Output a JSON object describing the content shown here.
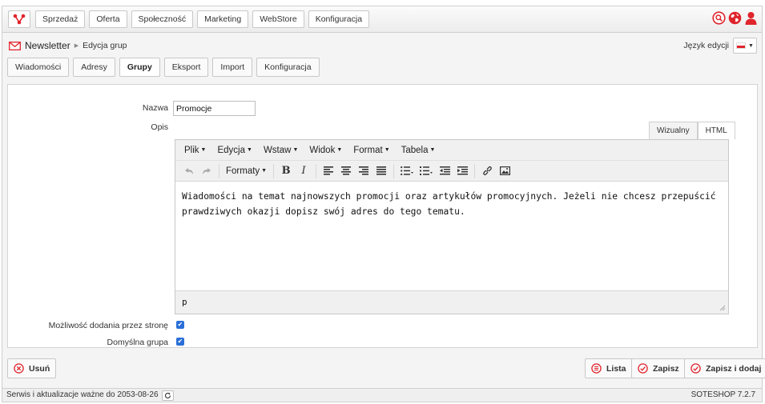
{
  "topnav": {
    "items": [
      "Sprzedaż",
      "Oferta",
      "Społeczność",
      "Marketing",
      "WebStore",
      "Konfiguracja"
    ]
  },
  "breadcrumb": {
    "module": "Newsletter",
    "page": "Edycja grup"
  },
  "language": {
    "label": "Język edycji"
  },
  "tabs": {
    "items": [
      "Wiadomości",
      "Adresy",
      "Grupy",
      "Eksport",
      "Import",
      "Konfiguracja"
    ],
    "active": "Grupy"
  },
  "form": {
    "name_label": "Nazwa",
    "name_value": "Promocje",
    "description_label": "Opis",
    "editor_tabs": [
      "Wizualny",
      "HTML"
    ],
    "menus": [
      "Plik",
      "Edycja",
      "Wstaw",
      "Widok",
      "Format",
      "Tabela"
    ],
    "formats_label": "Formaty",
    "content": "Wiadomości na temat najnowszych promocji oraz artykułów promocyjnych. Jeżeli nie chcesz przepuścić prawdziwych okazji dopisz swój adres do tego tematu.",
    "status_path": "p",
    "allow_label": "Możliwość dodania przez stronę",
    "default_label": "Domyślna grupa"
  },
  "actions": {
    "delete": "Usuń",
    "list": "Lista",
    "save": "Zapisz",
    "save_add": "Zapisz i dodaj"
  },
  "footer": {
    "left": "Serwis i aktualizacje ważne do 2053-08-26",
    "version": "SOTESHOP 7.2.7"
  },
  "colors": {
    "accent_red": "#e0242c",
    "checkbox_blue": "#2a6fd8"
  }
}
